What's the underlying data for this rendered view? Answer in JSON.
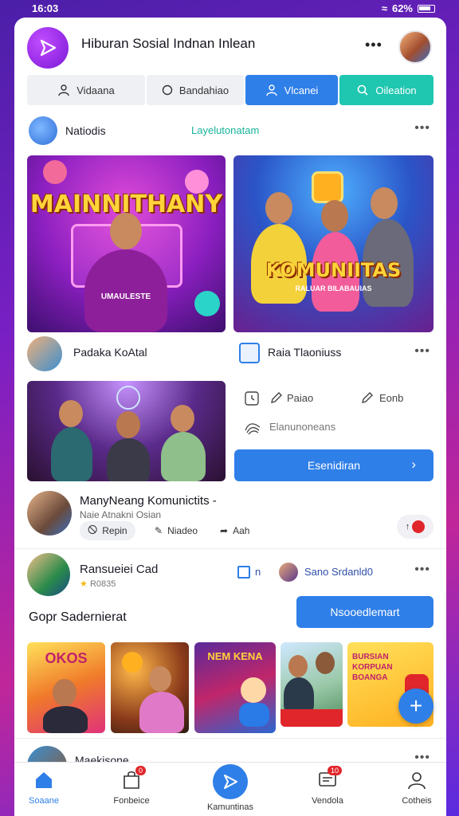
{
  "status": {
    "time": "16:03",
    "right": "62%"
  },
  "header": {
    "title": "Hiburan Sosial Indnan Inlean"
  },
  "tabs": [
    {
      "label": "Vidaana",
      "icon": "user-icon"
    },
    {
      "label": "Bandahiao",
      "icon": "circle-icon"
    },
    {
      "label": "Vlcanei",
      "icon": "user-icon"
    },
    {
      "label": "Oileation",
      "icon": "search-icon"
    }
  ],
  "section1": {
    "title": "Natiodis",
    "link": "Layelutonatam"
  },
  "image1": {
    "caption": "MAINNITHANY",
    "shirt": "UMAULESTE"
  },
  "image2": {
    "caption": "KOMUNIITAS",
    "sub": "RALUAR BILABAUIAS"
  },
  "row2": {
    "left_title": "Padaka KoAtal",
    "right_title": "Raia Tlaoniuss"
  },
  "actions": {
    "a1": "Paiao",
    "a2": "Eonb",
    "a3": "Elanunoneans"
  },
  "blue_button": "Esenidiran",
  "post": {
    "title": "ManyNeang Komunictits -",
    "subtitle": "Naie Atnakni Osian"
  },
  "post_chips": {
    "c1": "Repin",
    "c2": "Niadeo",
    "c3": "Aah"
  },
  "section3": {
    "title": "Ransueiei Cad",
    "sub": "R0835",
    "count": "n",
    "other": "Sano Srdanld0"
  },
  "section4": {
    "title": "Gopr Sadernierat",
    "button": "Nsooedlemart"
  },
  "thumbs": [
    {
      "text": "OKOS"
    },
    {
      "text": ""
    },
    {
      "text": "NEM  KENA"
    },
    {
      "text": ""
    },
    {
      "text": "BURSIAN KORPUAN BOANGA"
    }
  ],
  "section5": {
    "title": "Maekisone"
  },
  "nav": [
    {
      "label": "Soaane",
      "icon": "home-icon"
    },
    {
      "label": "Fonbeice",
      "icon": "bag-icon",
      "badge": "0"
    },
    {
      "label": "Kamuntinas",
      "icon": "play-icon"
    },
    {
      "label": "Vendola",
      "icon": "message-icon",
      "badge": "10"
    },
    {
      "label": "Cotheis",
      "icon": "profile-icon"
    }
  ]
}
